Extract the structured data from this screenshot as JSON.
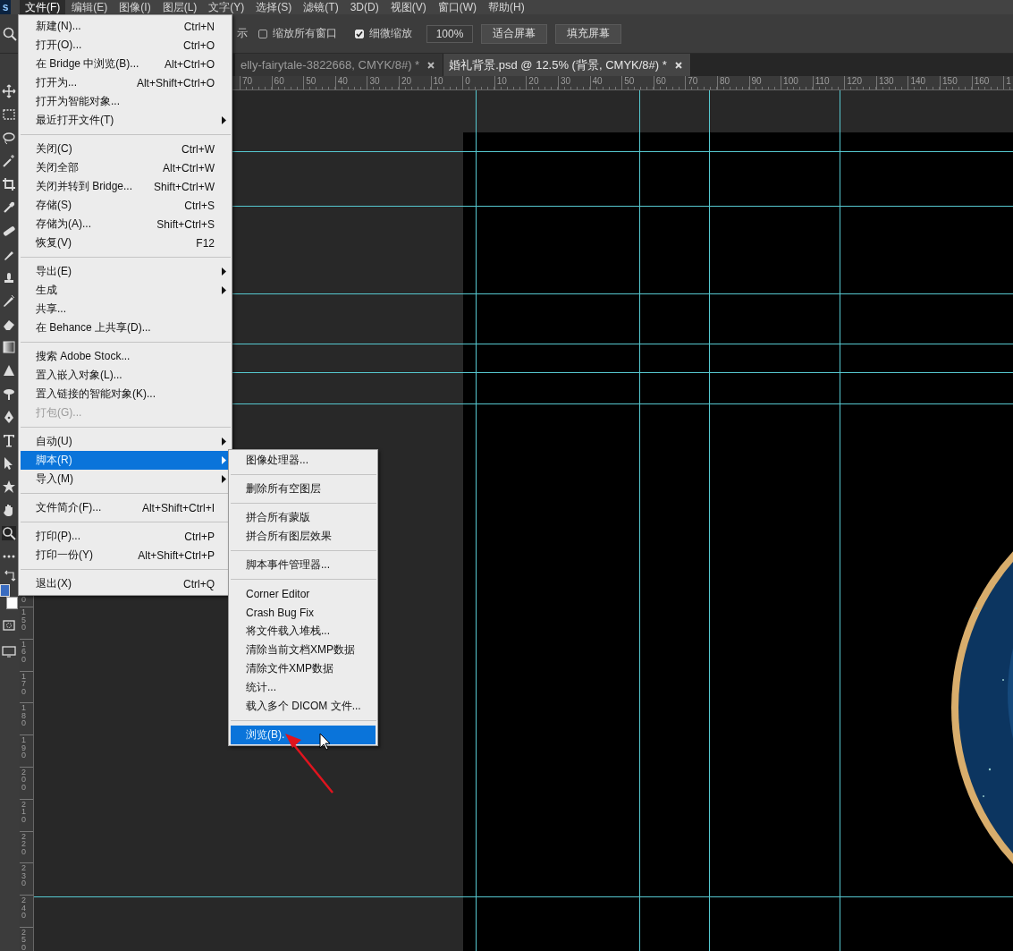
{
  "app_logo": "s",
  "menubar": [
    {
      "label": "文件(F)",
      "selected": true
    },
    {
      "label": "编辑(E)",
      "selected": false
    },
    {
      "label": "图像(I)",
      "selected": false
    },
    {
      "label": "图层(L)",
      "selected": false
    },
    {
      "label": "文字(Y)",
      "selected": false
    },
    {
      "label": "选择(S)",
      "selected": false
    },
    {
      "label": "滤镜(T)",
      "selected": false
    },
    {
      "label": "3D(D)",
      "selected": false
    },
    {
      "label": "视图(V)",
      "selected": false
    },
    {
      "label": "窗口(W)",
      "selected": false
    },
    {
      "label": "帮助(H)",
      "selected": false
    }
  ],
  "options_bar": {
    "partial_label": "示",
    "checkboxes": [
      {
        "label": "缩放所有窗口",
        "checked": false
      },
      {
        "label": "细微缩放",
        "checked": true
      }
    ],
    "zoom_field": {
      "value": "100%"
    },
    "buttons": [
      "适合屏幕",
      "填充屏幕"
    ]
  },
  "document_tabs": [
    {
      "title": "elly-fairytale-3822668, CMYK/8#) *",
      "selected": false
    },
    {
      "title": "婚礼背景.psd @ 12.5% (背景, CMYK/8#) *",
      "selected": true
    }
  ],
  "horizontal_ruler": [
    "70",
    "60",
    "50",
    "40",
    "30",
    "20",
    "10",
    "0",
    "10",
    "20",
    "30",
    "40",
    "50",
    "60",
    "70",
    "80",
    "90",
    "100",
    "110",
    "120",
    "130",
    "140",
    "150",
    "160",
    "1"
  ],
  "vertical_ruler": [
    "0",
    "150",
    "160",
    "170",
    "180",
    "190",
    "200",
    "210",
    "220",
    "230",
    "240",
    "250"
  ],
  "file_menu": {
    "sections": [
      [
        {
          "label": "新建(N)...",
          "shortcut": "Ctrl+N",
          "has_submenu": false,
          "disabled": false,
          "selected": false
        },
        {
          "label": "打开(O)...",
          "shortcut": "Ctrl+O",
          "has_submenu": false,
          "disabled": false,
          "selected": false
        },
        {
          "label": "在 Bridge 中浏览(B)...",
          "shortcut": "Alt+Ctrl+O",
          "has_submenu": false,
          "disabled": false,
          "selected": false
        },
        {
          "label": "打开为...",
          "shortcut": "Alt+Shift+Ctrl+O",
          "has_submenu": false,
          "disabled": false,
          "selected": false
        },
        {
          "label": "打开为智能对象...",
          "has_submenu": false,
          "disabled": false,
          "selected": false
        },
        {
          "label": "最近打开文件(T)",
          "has_submenu": true,
          "disabled": false,
          "selected": false
        }
      ],
      [
        {
          "label": "关闭(C)",
          "shortcut": "Ctrl+W",
          "has_submenu": false,
          "disabled": false,
          "selected": false
        },
        {
          "label": "关闭全部",
          "shortcut": "Alt+Ctrl+W",
          "has_submenu": false,
          "disabled": false,
          "selected": false
        },
        {
          "label": "关闭并转到 Bridge...",
          "shortcut": "Shift+Ctrl+W",
          "has_submenu": false,
          "disabled": false,
          "selected": false
        },
        {
          "label": "存储(S)",
          "shortcut": "Ctrl+S",
          "has_submenu": false,
          "disabled": false,
          "selected": false
        },
        {
          "label": "存储为(A)...",
          "shortcut": "Shift+Ctrl+S",
          "has_submenu": false,
          "disabled": false,
          "selected": false
        },
        {
          "label": "恢复(V)",
          "shortcut": "F12",
          "has_submenu": false,
          "disabled": false,
          "selected": false
        }
      ],
      [
        {
          "label": "导出(E)",
          "has_submenu": true,
          "disabled": false,
          "selected": false
        },
        {
          "label": "生成",
          "has_submenu": true,
          "disabled": false,
          "selected": false
        },
        {
          "label": "共享...",
          "has_submenu": false,
          "disabled": false,
          "selected": false
        },
        {
          "label": "在 Behance 上共享(D)...",
          "has_submenu": false,
          "disabled": false,
          "selected": false
        }
      ],
      [
        {
          "label": "搜索 Adobe Stock...",
          "has_submenu": false,
          "disabled": false,
          "selected": false
        },
        {
          "label": "置入嵌入对象(L)...",
          "has_submenu": false,
          "disabled": false,
          "selected": false
        },
        {
          "label": "置入链接的智能对象(K)...",
          "has_submenu": false,
          "disabled": false,
          "selected": false
        },
        {
          "label": "打包(G)...",
          "has_submenu": false,
          "disabled": true,
          "selected": false
        }
      ],
      [
        {
          "label": "自动(U)",
          "has_submenu": true,
          "disabled": false,
          "selected": false
        },
        {
          "label": "脚本(R)",
          "has_submenu": true,
          "disabled": false,
          "selected": true
        },
        {
          "label": "导入(M)",
          "has_submenu": true,
          "disabled": false,
          "selected": false
        }
      ],
      [
        {
          "label": "文件简介(F)...",
          "shortcut": "Alt+Shift+Ctrl+I",
          "has_submenu": false,
          "disabled": false,
          "selected": false
        }
      ],
      [
        {
          "label": "打印(P)...",
          "shortcut": "Ctrl+P",
          "has_submenu": false,
          "disabled": false,
          "selected": false
        },
        {
          "label": "打印一份(Y)",
          "shortcut": "Alt+Shift+Ctrl+P",
          "has_submenu": false,
          "disabled": false,
          "selected": false
        }
      ],
      [
        {
          "label": "退出(X)",
          "shortcut": "Ctrl+Q",
          "has_submenu": false,
          "disabled": false,
          "selected": false
        }
      ]
    ]
  },
  "script_submenu": {
    "sections": [
      [
        {
          "label": "图像处理器...",
          "selected": false
        }
      ],
      [
        {
          "label": "删除所有空图层",
          "selected": false
        }
      ],
      [
        {
          "label": "拼合所有蒙版",
          "selected": false
        },
        {
          "label": "拼合所有图层效果",
          "selected": false
        }
      ],
      [
        {
          "label": "脚本事件管理器...",
          "selected": false
        }
      ],
      [
        {
          "label": "Corner Editor",
          "selected": false
        },
        {
          "label": "Crash Bug Fix",
          "selected": false
        },
        {
          "label": "将文件载入堆栈...",
          "selected": false
        },
        {
          "label": "清除当前文档XMP数据",
          "selected": false
        },
        {
          "label": "清除文件XMP数据",
          "selected": false
        },
        {
          "label": "统计...",
          "selected": false
        },
        {
          "label": "载入多个 DICOM 文件...",
          "selected": false
        }
      ],
      [
        {
          "label": "浏览(B).",
          "selected": true
        }
      ]
    ]
  }
}
